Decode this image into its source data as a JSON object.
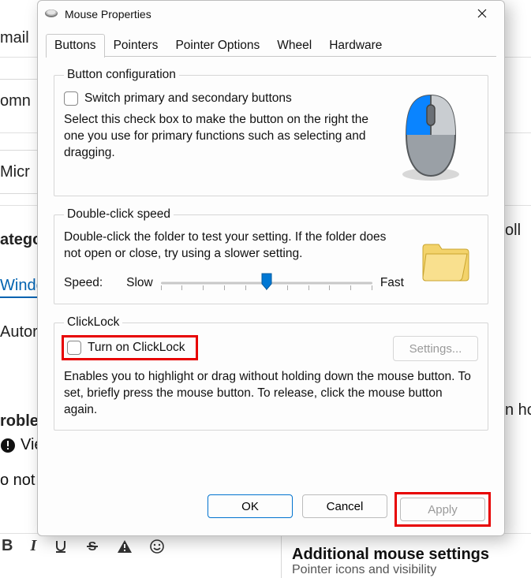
{
  "dialog": {
    "title": "Mouse Properties",
    "close": "✕",
    "tabs": [
      "Buttons",
      "Pointers",
      "Pointer Options",
      "Wheel",
      "Hardware"
    ],
    "active_tab": 0,
    "button_config": {
      "legend": "Button configuration",
      "checkbox_label": "Switch primary and secondary buttons",
      "checked": false,
      "desc": "Select this check box to make the button on the right the one you use for primary functions such as selecting and dragging."
    },
    "double_click": {
      "legend": "Double-click speed",
      "desc": "Double-click the folder to test your setting. If the folder does not open or close, try using a slower setting.",
      "speed_label": "Speed:",
      "slow_label": "Slow",
      "fast_label": "Fast",
      "value_percent": 50
    },
    "clicklock": {
      "legend": "ClickLock",
      "checkbox_label": "Turn on ClickLock",
      "checked": false,
      "settings_btn": "Settings...",
      "settings_enabled": false,
      "desc": "Enables you to highlight or drag without holding down the mouse button. To set, briefly press the mouse button. To release, click the mouse button again."
    },
    "buttons": {
      "ok": "OK",
      "cancel": "Cancel",
      "apply": "Apply",
      "apply_enabled": false
    }
  },
  "background": {
    "mail": "mail",
    "comments": "omn",
    "microsoft": "Micr",
    "categories": "atego",
    "windows": "Windo",
    "automatic": "Autor",
    "troubleshoot": "roble",
    "view": "Vie",
    "noti": "o not i",
    "right_oll": "oll",
    "right_nh": "n ho",
    "footer_title": "Additional mouse settings",
    "footer_sub": "Pointer icons and visibility",
    "tool_b": "B"
  },
  "colors": {
    "accent": "#0078d4",
    "highlight": "#e70000"
  }
}
